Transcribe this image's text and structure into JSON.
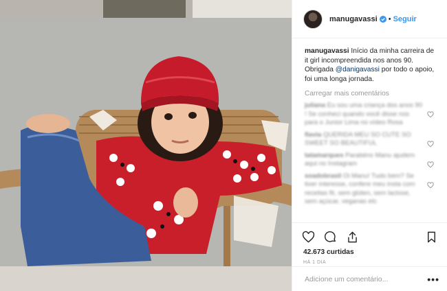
{
  "post": {
    "username": "manugavassi",
    "follow_label": "Seguir",
    "separator": "•",
    "caption": {
      "username": "manugavassi",
      "text_before": "Início da minha carreira de it girl incompreendida nos anos 90. Obrigada",
      "mention": "@danigavassi",
      "text_after": "por todo o apoio, foi uma longa jornada."
    },
    "load_more": "Carregar mais comentários",
    "comments": [
      {
        "username": "juliana",
        "text": "Eu sou uma criança dos anos 90 ! Se conheci quando você disse nos para o Junior Lima no vídeo Rosa"
      },
      {
        "username": "flavia",
        "text": "QUERIDA MEU SO CUTE SO SWEET SO BEAUTIFUL"
      },
      {
        "username": "tatamarques",
        "text": "Parabéns Manu ajudem aqui no Instagram"
      },
      {
        "username": "soadobrasil",
        "text": "Oi Manu! Tudo bem? Se tiver interesse, confere meu insta com receitas fit, sem glúten, sem lactose, sem açúcar, veganas etc"
      }
    ],
    "likes": "42.673 curtidas",
    "time": "HÁ 1 DIA",
    "comment_placeholder": "Adicione um comentário...",
    "more_label": "•••"
  },
  "colors": {
    "accent": "#3897f0",
    "verified": "#3897f0",
    "muted": "#999999",
    "border": "#efefef"
  },
  "icons": [
    "heart-icon",
    "comment-icon",
    "share-icon",
    "bookmark-icon",
    "verified-icon"
  ]
}
